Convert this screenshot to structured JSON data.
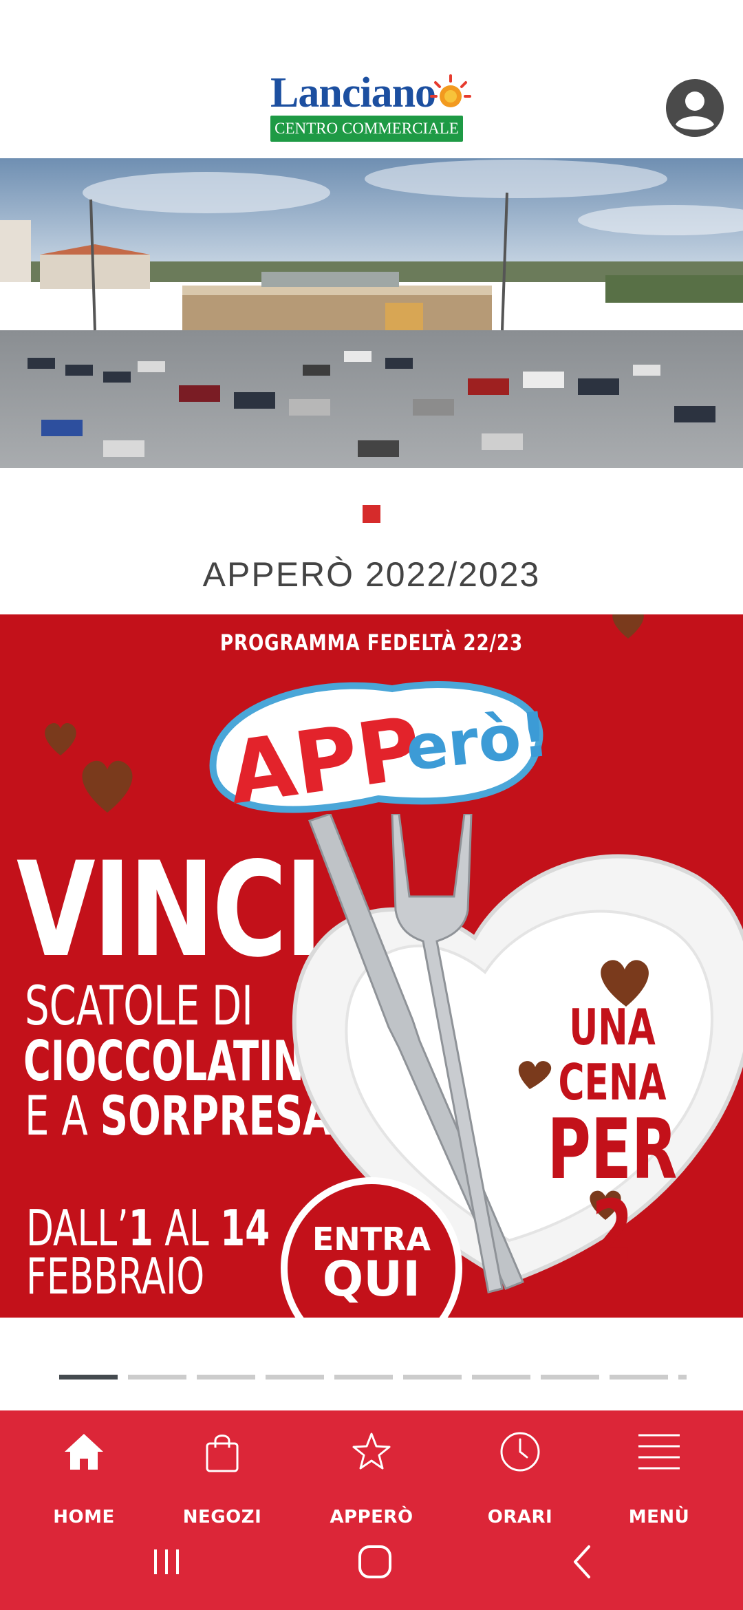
{
  "header": {
    "logo_word": "Lanciano",
    "logo_band": "CENTRO COMMERCIALE",
    "account_icon": "account-circle-icon"
  },
  "hero": {
    "carousel_dots": 1,
    "active_dot": 0
  },
  "section_title": "APPERÒ 2022/2023",
  "banner": {
    "program": "PROGRAMMA FEDELTÀ 22/23",
    "logo_text_a": "APP",
    "logo_text_b": "erò!",
    "vinci": "VINCI",
    "line2": "SCATOLE DI",
    "line3": "CIOCCOLATINI",
    "line4_light": "E A",
    "line4_bold": "SORPRESA...",
    "date_prefix": "DALL’",
    "date_start": "1",
    "date_mid": "AL",
    "date_end": "14",
    "date_month": "FEBBRAIO",
    "prize_line1": "UNA CENA",
    "prize_line2": "PER 2",
    "cta_line1": "ENTRA",
    "cta_line2": "QUI"
  },
  "pager": {
    "total_segments": 9,
    "active_index": 0
  },
  "nav": {
    "items": [
      {
        "label": "HOME",
        "icon": "home-icon"
      },
      {
        "label": "NEGOZI",
        "icon": "shopping-bag-icon"
      },
      {
        "label": "APPERÒ",
        "icon": "star-icon"
      },
      {
        "label": "ORARI",
        "icon": "clock-icon"
      },
      {
        "label": "MENÙ",
        "icon": "menu-icon"
      }
    ]
  },
  "colors": {
    "brand_red": "#dc2638",
    "banner_red": "#c3111a",
    "dot_red": "#d62b2b"
  }
}
